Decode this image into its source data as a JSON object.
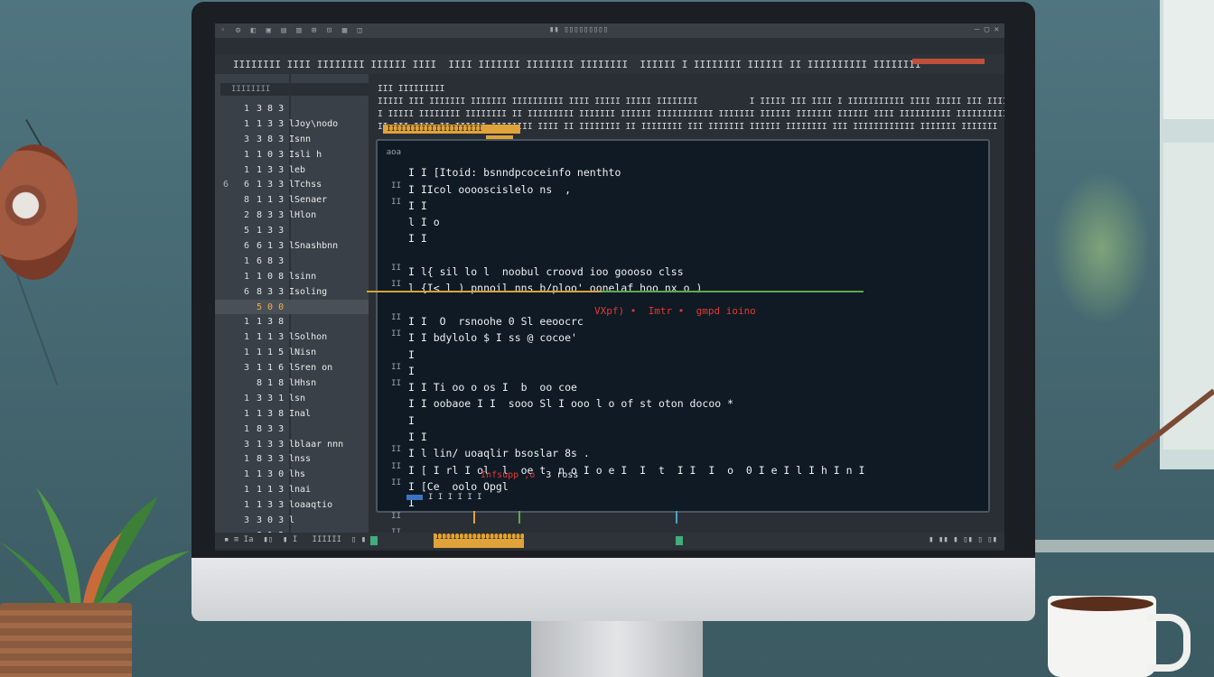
{
  "titlebar": {
    "icons": "◦ ⚙ ◧ ▣ ▤ ▥ ⊞ ⊡ ▦ ◫",
    "center": "▮▮ ▯▯▯▯▯▯▯▯▯",
    "minmax": "— ▢ ✕"
  },
  "menubar": {
    "text": "IIIIIIII IIII IIIIIIII IIIIII IIII  IIII IIIIIII IIIIIIII IIIIIIII  IIIIII I IIIIIIII IIIIII II IIIIIIIIII IIIIIIII"
  },
  "sidebar": {
    "search_placeholder": "IIIIIIII",
    "rows": [
      {
        "ln": "",
        "ix": "1",
        "num": "3 8 3",
        "lbl": ""
      },
      {
        "ln": "",
        "ix": "1",
        "num": "1 3 3",
        "lbl": "lJoy\\nodo"
      },
      {
        "ln": "",
        "ix": "3",
        "num": "3 8 3",
        "lbl": "Isnn"
      },
      {
        "ln": "",
        "ix": "1",
        "num": "1 0 3",
        "lbl": "Isli h"
      },
      {
        "ln": "",
        "ix": "1",
        "num": "1 3 3",
        "lbl": "leb"
      },
      {
        "ln": "6",
        "ix": "6",
        "num": "1 3 3",
        "lbl": "lTchss"
      },
      {
        "ln": "",
        "ix": "8",
        "num": "1 1 3",
        "lbl": "lSenaer"
      },
      {
        "ln": "",
        "ix": "2",
        "num": "8 3 3",
        "lbl": "lHlon"
      },
      {
        "ln": "",
        "ix": "5",
        "num": "1 3 3",
        "lbl": ""
      },
      {
        "ln": "",
        "ix": "6",
        "num": "6 1 3",
        "lbl": "lSnashbnn"
      },
      {
        "ln": "",
        "ix": "1",
        "num": "6 8 3",
        "lbl": ""
      },
      {
        "ln": "",
        "ix": "1",
        "num": "1 0 8",
        "lbl": "lsinn"
      },
      {
        "ln": "",
        "ix": "6",
        "num": "8 3 3",
        "lbl": "Isoling"
      },
      {
        "ln": "",
        "ix": "",
        "num": "5 0 0",
        "lbl": "",
        "active": true
      },
      {
        "ln": "",
        "ix": "1",
        "num": "1 3 8",
        "lbl": ""
      },
      {
        "ln": "",
        "ix": "1",
        "num": "1 1 3",
        "lbl": "lSolhon"
      },
      {
        "ln": "",
        "ix": "1",
        "num": "1 1 5",
        "lbl": "lNisn"
      },
      {
        "ln": "",
        "ix": "3",
        "num": "1 1 6",
        "lbl": "lSren on"
      },
      {
        "ln": "",
        "ix": "",
        "num": "8 1 8",
        "lbl": "lHhsn"
      },
      {
        "ln": "",
        "ix": "1",
        "num": "3 3 1",
        "lbl": "lsn"
      },
      {
        "ln": "",
        "ix": "1",
        "num": "1 3 8",
        "lbl": "Inal"
      },
      {
        "ln": "",
        "ix": "1",
        "num": "8 3 3",
        "lbl": ""
      },
      {
        "ln": "",
        "ix": "3",
        "num": "1 3 3",
        "lbl": "lblaar nnn"
      },
      {
        "ln": "",
        "ix": "1",
        "num": "8 3 3",
        "lbl": "lnss"
      },
      {
        "ln": "",
        "ix": "1",
        "num": "1 3 0",
        "lbl": "lhs"
      },
      {
        "ln": "",
        "ix": "1",
        "num": "1 1 3",
        "lbl": "lnai"
      },
      {
        "ln": "",
        "ix": "1",
        "num": "1 3 3",
        "lbl": "loaaqtio"
      },
      {
        "ln": "",
        "ix": "3",
        "num": "3 0 3",
        "lbl": "l"
      },
      {
        "ln": "",
        "ix": "",
        "num": "8 1 3",
        "lbl": ""
      }
    ]
  },
  "header": {
    "lines": [
      "III IIIIIIIII",
      "IIIII III IIIIIII IIIIIII IIIIIIIIII IIII IIIII IIIII IIIIIIII          I IIIII III IIII I IIIIIIIIIII IIII IIIII III IIII",
      "I IIIII IIIIIIII IIIIIIII II IIIIIIIII IIIIIII IIIIII IIIIIIIIIII IIIIIII IIIIII IIIIIII IIIIII IIII IIIIIIIIII IIIIIIIIIII IIIII",
      "II III IIII II IIIIII IIIIIIII IIII II IIIIIIII II IIIIIIII III IIIIIII IIIIII IIIIIIII III IIIIIIIIIIII IIIIIII IIIIIII"
    ],
    "tag": "IIIIIIIIIIIIIIIIIIIIII"
  },
  "editor": {
    "gutter": [
      "aoa",
      "",
      "II",
      "II",
      "",
      "",
      "",
      "II",
      "II",
      "",
      "II",
      "II",
      "",
      "II",
      "II",
      "",
      "",
      "",
      "II",
      "II",
      "II",
      "",
      "II",
      "II"
    ],
    "lines": [
      "",
      "I I [Itoid: bsnndpcoceinfo nenthto",
      "I IIcol ooooscislelo ns  ,",
      "I I",
      "l I o",
      "I I",
      "",
      "I l{ sil lo l  noobul croovd ioo goooso clss",
      "l {I< l ) pnnoil nns b/ploo' oonelaf hoo nx o )",
      "",
      "I I  O  rsnoohe 0 Sl eeoocrc",
      "I I bdylolo $ I ss @ cocoe'",
      "I",
      "I",
      "I I Ti oo o os I  b  oo coe",
      "I I oobaoe I I  sooo Sl I ooo l o of st oton docoo *",
      "I",
      "I I",
      "I l lin/ uoaqlir bsoslar 8s .",
      "I [ I rl I ol  l  oe t  n o I o e I  I  t  I I  I  o  0 I e I l I h I n I",
      "I [Ce  oolo Opgl",
      "I",
      "",
      ""
    ],
    "error_inline": "VXpf) •  Imtr •  gmpd ioino",
    "error_bottom": "  Infsupp ,o",
    "error_bottom_rest": "  3 ross",
    "status": "I I I I I I"
  },
  "statusbar": {
    "left": "▪ ≡ Ia  ▮▯  ▮ I   IIIIII  ▯ ▮",
    "badge": "IIIIIIIIIIIIIIIIIIIIIIIIIIIIIIIIIIIII",
    "right": "▮ ▮▮ ▮ ▯▮ ▯ ▯▮"
  },
  "colors": {
    "editor_bg": "#0f1a24",
    "accent_orange": "#e0a33a",
    "error_red": "#e43a32",
    "accent_green": "#5fa84a"
  }
}
